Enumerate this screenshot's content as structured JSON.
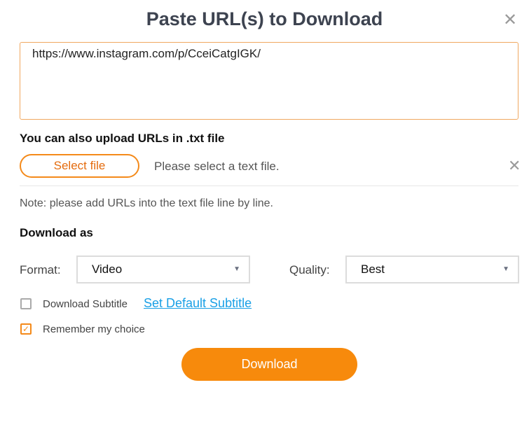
{
  "dialog": {
    "title": "Paste URL(s) to Download",
    "close_icon": "close-icon"
  },
  "url_input": {
    "value": "https://www.instagram.com/p/CceiCatgIGK/"
  },
  "upload": {
    "heading": "You can also upload URLs in .txt file",
    "select_label": "Select file",
    "hint": "Please select a text file.",
    "note": "Note: please add URLs into the text file line by line."
  },
  "download_as": {
    "heading": "Download as",
    "format_label": "Format:",
    "format_value": "Video",
    "quality_label": "Quality:",
    "quality_value": "Best"
  },
  "options": {
    "subtitle_label": "Download Subtitle",
    "subtitle_checked": false,
    "subtitle_link": "Set Default Subtitle",
    "remember_label": "Remember my choice",
    "remember_checked": true
  },
  "download_button": "Download",
  "colors": {
    "accent": "#f78a0c",
    "link": "#1aa0e6"
  }
}
